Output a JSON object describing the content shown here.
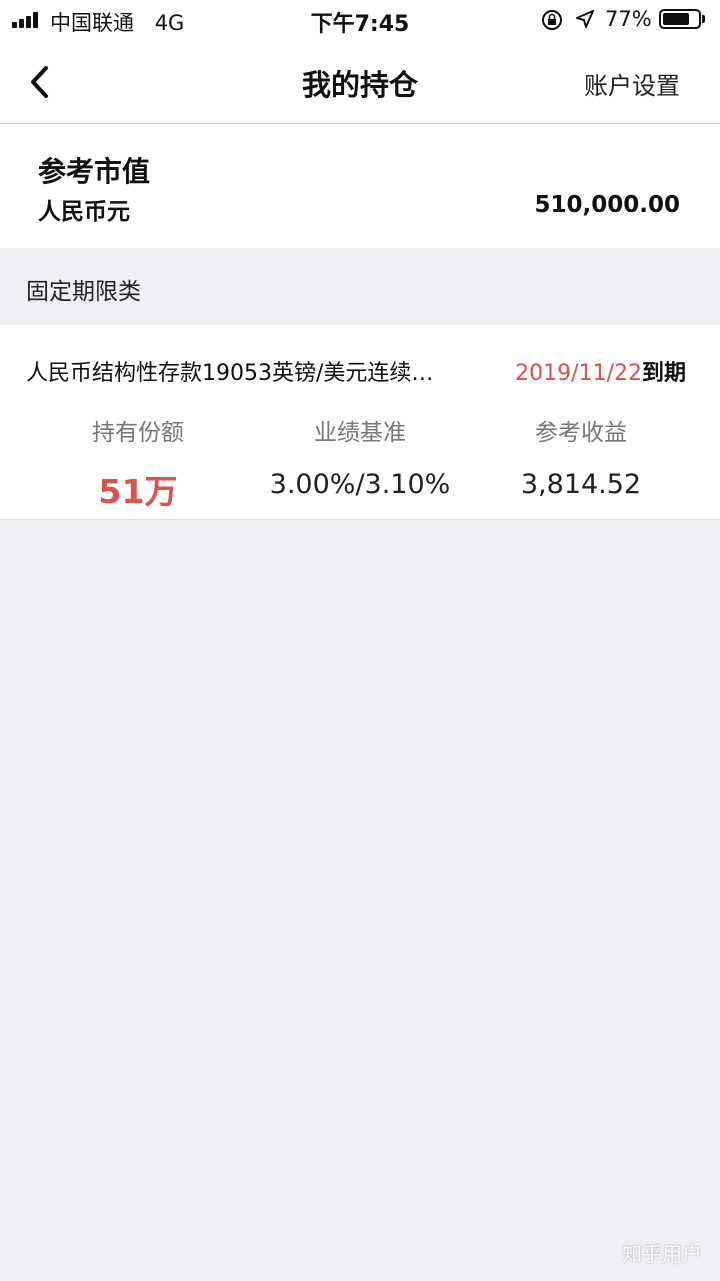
{
  "status_bar": {
    "carrier": "中国联通",
    "network": "4G",
    "time": "下午7:45",
    "battery_percent_text": "77%",
    "battery_level": 0.77
  },
  "nav": {
    "title": "我的持仓",
    "settings_label": "账户设置",
    "back_icon": "chevron-left-icon"
  },
  "market": {
    "title": "参考市值",
    "currency": "人民币元",
    "value": "510,000.00"
  },
  "section": {
    "title": "固定期限类"
  },
  "product": {
    "name": "人民币结构性存款19053英镑/美元连续…",
    "maturity_date": "2019/11/22",
    "maturity_suffix": "到期",
    "metrics": [
      {
        "label": "持有份额",
        "value": "51万"
      },
      {
        "label": "业绩基准",
        "value": "3.00%/3.10%"
      },
      {
        "label": "参考收益",
        "value": "3,814.52"
      }
    ]
  },
  "watermark": "知乎用户",
  "colors": {
    "accent_red": "#d9534f",
    "background": "#efeff4"
  }
}
